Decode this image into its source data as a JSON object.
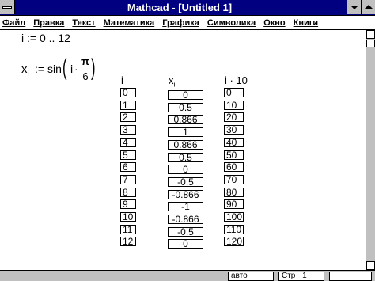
{
  "window": {
    "title": "Mathcad - [Untitled 1]"
  },
  "menu": {
    "items": [
      {
        "label": "Файл",
        "name": "menu-file"
      },
      {
        "label": "Правка",
        "name": "menu-edit"
      },
      {
        "label": "Текст",
        "name": "menu-text"
      },
      {
        "label": "Математика",
        "name": "menu-math"
      },
      {
        "label": "Графика",
        "name": "menu-graphics"
      },
      {
        "label": "Символика",
        "name": "menu-symbolics"
      },
      {
        "label": "Окно",
        "name": "menu-window"
      },
      {
        "label": "Книги",
        "name": "menu-books"
      }
    ]
  },
  "worksheet": {
    "range_def": {
      "var": "i",
      "assign": ":=",
      "range": "0 .. 12"
    },
    "x_def": {
      "lhs": "x",
      "lhs_sub": "i",
      "assign": ":=",
      "func": "sin",
      "arg": "i",
      "dot": "·",
      "numerator": "π",
      "denominator": "6"
    },
    "tables": {
      "i": {
        "header": "i",
        "values": [
          "0",
          "1",
          "2",
          "3",
          "4",
          "5",
          "6",
          "7",
          "8",
          "9",
          "10",
          "11",
          "12"
        ]
      },
      "x": {
        "header": "x",
        "header_sub": "i",
        "values": [
          "0",
          "0.5",
          "0.866",
          "1",
          "0.866",
          "0.5",
          "0",
          "-0.5",
          "-0.866",
          "-1",
          "-0.866",
          "-0.5",
          "0"
        ]
      },
      "i10": {
        "header": "i · 10",
        "values": [
          "0",
          "10",
          "20",
          "30",
          "40",
          "50",
          "60",
          "70",
          "80",
          "90",
          "100",
          "110",
          "120"
        ]
      }
    }
  },
  "status": {
    "mode": "авто",
    "page_label": "Стр",
    "page_number": "1"
  }
}
